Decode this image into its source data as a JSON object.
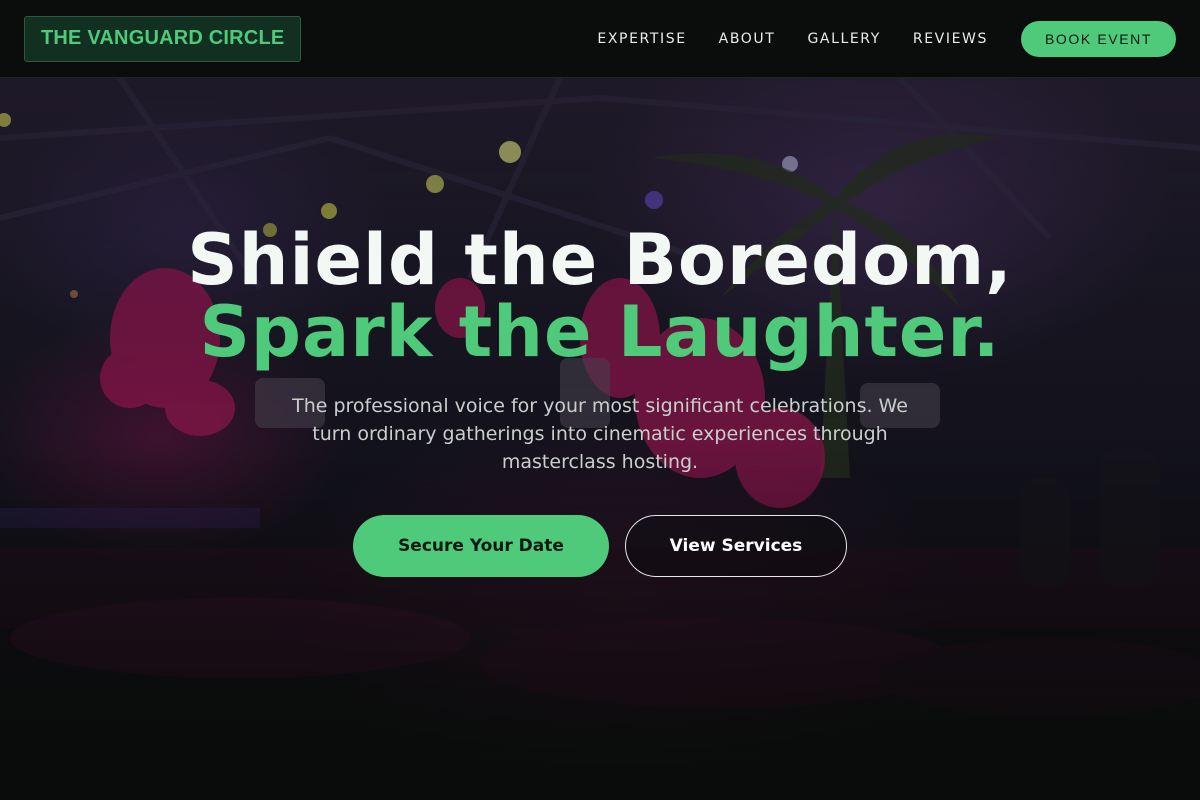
{
  "header": {
    "logo_text": "THE VANGUARD CIRCLE",
    "nav": [
      {
        "label": "EXPERTISE"
      },
      {
        "label": "ABOUT"
      },
      {
        "label": "GALLERY"
      },
      {
        "label": "REVIEWS"
      }
    ],
    "book_label": "BOOK EVENT"
  },
  "hero": {
    "headline_line1": "Shield the Boredom,",
    "headline_line2": "Spark the Laughter.",
    "subtext": "The professional voice for your most significant celebrations. We turn ordinary gatherings into cinematic experiences through masterclass hosting.",
    "primary_cta": "Secure Your Date",
    "secondary_cta": "View Services"
  },
  "theme": {
    "accent": "#4fc97a",
    "background": "#0a0c0b",
    "text": "#f3f8f4"
  }
}
